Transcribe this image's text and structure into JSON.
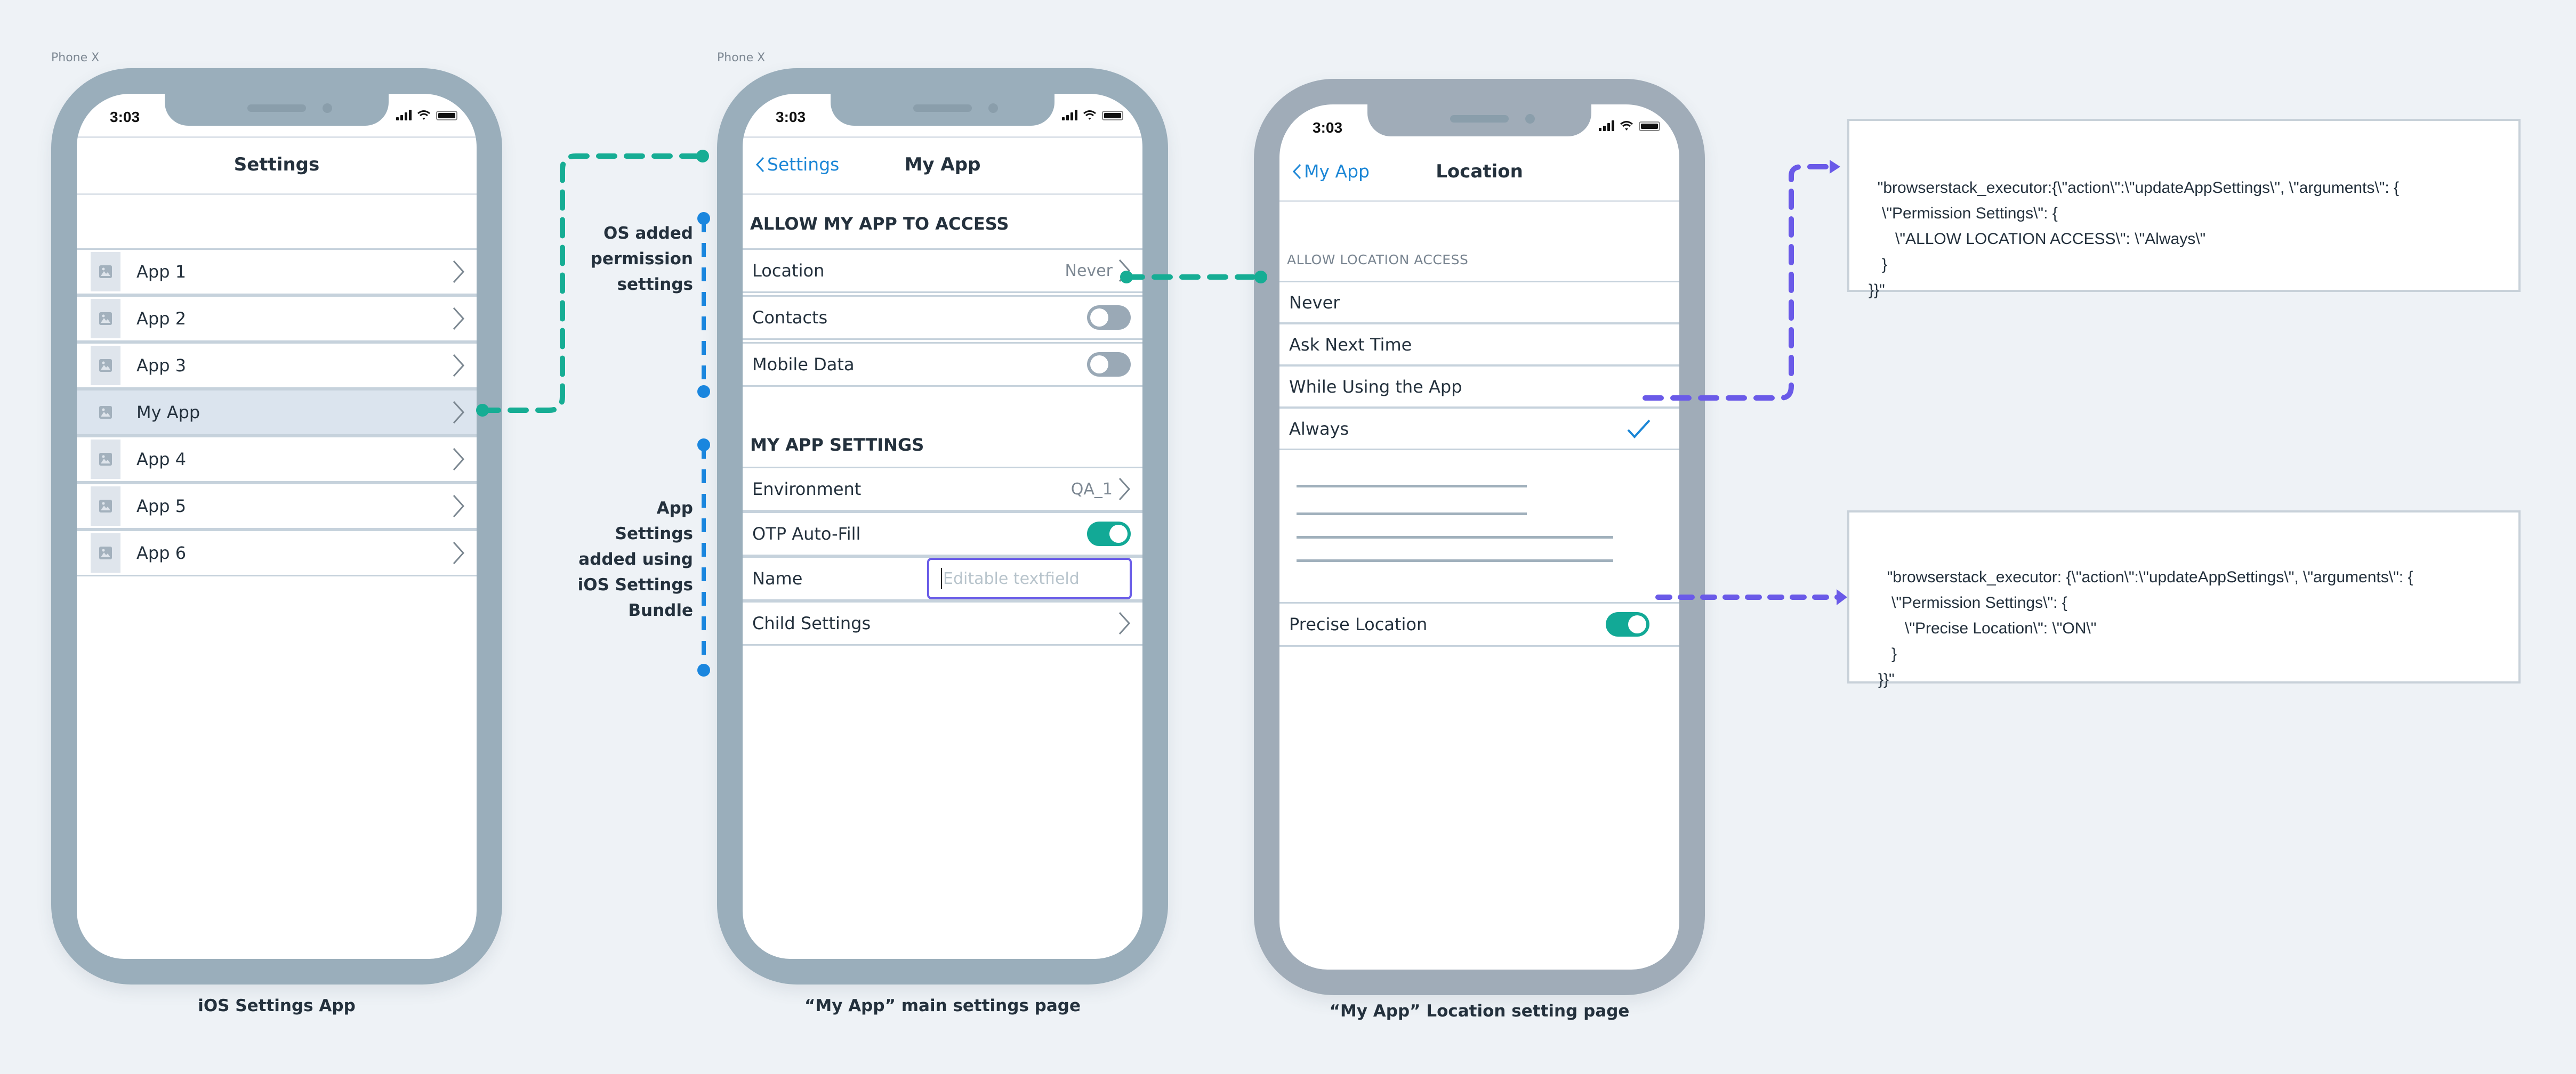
{
  "device_labels": [
    "Phone X",
    "Phone X"
  ],
  "status_bar": {
    "time": "3:03"
  },
  "phone1": {
    "title": "Settings",
    "apps": [
      {
        "label": "App 1",
        "selected": false
      },
      {
        "label": "App 2",
        "selected": false
      },
      {
        "label": "App 3",
        "selected": false
      },
      {
        "label": "My App",
        "selected": true
      },
      {
        "label": "App 4",
        "selected": false
      },
      {
        "label": "App 5",
        "selected": false
      },
      {
        "label": "App 6",
        "selected": false
      }
    ],
    "caption": "iOS Settings App"
  },
  "phone2": {
    "back_label": "Settings",
    "title": "My App",
    "section1_header": "ALLOW MY APP TO ACCESS",
    "location": {
      "label": "Location",
      "value": "Never"
    },
    "contacts": {
      "label": "Contacts",
      "on": false
    },
    "mobile_data": {
      "label": "Mobile Data",
      "on": false
    },
    "section2_header": "MY APP SETTINGS",
    "environment": {
      "label": "Environment",
      "value": "QA_1"
    },
    "otp": {
      "label": "OTP Auto-Fill",
      "on": true
    },
    "name": {
      "label": "Name",
      "placeholder": "Editable textfield",
      "value": ""
    },
    "child_settings": {
      "label": "Child Settings"
    },
    "caption": "“My App” main settings page"
  },
  "phone3": {
    "back_label": "My App",
    "title": "Location",
    "section_header": "ALLOW LOCATION ACCESS",
    "options": [
      {
        "label": "Never",
        "checked": false
      },
      {
        "label": "Ask Next Time",
        "checked": false
      },
      {
        "label": "While Using the App",
        "checked": false
      },
      {
        "label": "Always",
        "checked": true
      }
    ],
    "precise_location": {
      "label": "Precise Location",
      "on": true
    },
    "caption": "“My App” Location setting page"
  },
  "annotations": {
    "os_added": "OS added\npermission\nsettings",
    "app_settings": "App\nSettings\nadded using\niOS Settings\nBundle"
  },
  "code_blocks": [
    "\"browserstack_executor:{\\\"action\\\":\\\"updateAppSettings\\\", \\\"arguments\\\": {\n   \\\"Permission Settings\\\": {\n      \\\"ALLOW LOCATION ACCESS\\\": \\\"Always\\\"\n   }\n}}\"",
    "\"browserstack_executor: {\\\"action\\\":\\\"updateAppSettings\\\", \\\"arguments\\\": {\n   \\\"Permission Settings\\\": {\n      \\\"Precise Location\\\": \\\"ON\\\"\n   }\n}}\""
  ],
  "colors": {
    "background": "#eef2f6",
    "phone_frame": "#9aaebb",
    "ios_blue": "#1b86d6",
    "toggle_on": "#12a996",
    "connector_teal": "#16ad94",
    "connector_blue": "#1a86de",
    "connector_purple": "#6a5ae8",
    "textfield_focus": "#6a5de8"
  }
}
